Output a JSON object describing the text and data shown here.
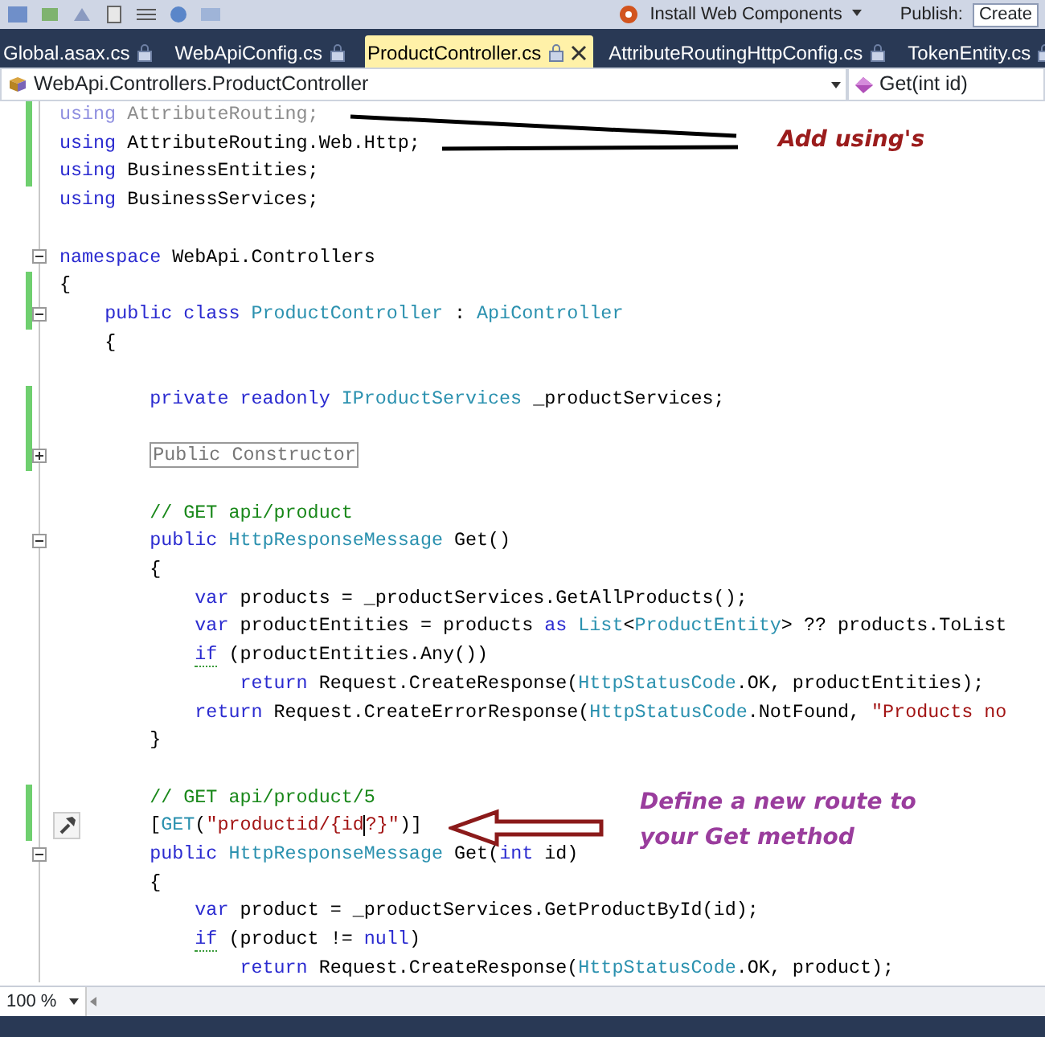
{
  "toolbar": {
    "install_button": "Install Web Components",
    "publish_label": "Publish:",
    "publish_field": "Create"
  },
  "tabs": [
    {
      "label": "Global.asax.cs",
      "selected": false
    },
    {
      "label": "WebApiConfig.cs",
      "selected": false
    },
    {
      "label": "ProductController.cs",
      "selected": true
    },
    {
      "label": "AttributeRoutingHttpConfig.cs",
      "selected": false
    },
    {
      "label": "TokenEntity.cs",
      "selected": false
    }
  ],
  "navigation": {
    "type_dropdown": "WebApi.Controllers.ProductController",
    "member_dropdown": "Get(int id)"
  },
  "editor": {
    "lines": [
      {
        "changed": true,
        "tokens": [
          {
            "kind": "keyword_dim",
            "text": "using "
          },
          {
            "kind": "dim",
            "text": "AttributeRouting;"
          }
        ]
      },
      {
        "changed": true,
        "tokens": [
          {
            "kind": "keyword",
            "text": "using "
          },
          {
            "kind": "plain",
            "text": "AttributeRouting.Web.Http;"
          }
        ]
      },
      {
        "changed": true,
        "tokens": [
          {
            "kind": "keyword",
            "text": "using "
          },
          {
            "kind": "plain",
            "text": "BusinessEntities;"
          }
        ]
      },
      {
        "changed": false,
        "tokens": [
          {
            "kind": "keyword",
            "text": "using "
          },
          {
            "kind": "plain",
            "text": "BusinessServices;"
          }
        ]
      },
      {
        "changed": false
      },
      {
        "changed": false,
        "expanded": true,
        "tokens": [
          {
            "kind": "keyword",
            "text": "namespace "
          },
          {
            "kind": "plain",
            "text": "WebApi.Controllers"
          }
        ]
      },
      {
        "changed": true,
        "tokens": [
          {
            "kind": "plain",
            "text": "{"
          }
        ]
      },
      {
        "changed": true,
        "expanded": true,
        "tokens": [
          {
            "kind": "keyword",
            "text": "    public class "
          },
          {
            "kind": "type",
            "text": "ProductController"
          },
          {
            "kind": "plain",
            "text": " : "
          },
          {
            "kind": "type",
            "text": "ApiController"
          }
        ]
      },
      {
        "changed": false,
        "tokens": [
          {
            "kind": "plain",
            "text": "    {"
          }
        ]
      },
      {
        "changed": false
      },
      {
        "changed": true,
        "tokens": [
          {
            "kind": "keyword",
            "text": "        private readonly "
          },
          {
            "kind": "type",
            "text": "IProductServices"
          },
          {
            "kind": "plain",
            "text": " _productServices;"
          }
        ]
      },
      {
        "changed": true
      },
      {
        "changed": true,
        "expanded": false,
        "tokens": [
          {
            "kind": "collapsed",
            "text": "        Public Constructor"
          }
        ]
      },
      {
        "changed": false
      },
      {
        "changed": false,
        "tokens": [
          {
            "kind": "comment",
            "text": "        // GET api/product"
          }
        ]
      },
      {
        "changed": false,
        "expanded": true,
        "tokens": [
          {
            "kind": "keyword",
            "text": "        public "
          },
          {
            "kind": "type",
            "text": "HttpResponseMessage"
          },
          {
            "kind": "plain",
            "text": " Get()"
          }
        ]
      },
      {
        "changed": false,
        "tokens": [
          {
            "kind": "plain",
            "text": "        {"
          }
        ]
      },
      {
        "changed": false,
        "tokens": [
          {
            "kind": "keyword",
            "text": "            var "
          },
          {
            "kind": "plain",
            "text": "products = _productServices.GetAllProducts();"
          }
        ]
      },
      {
        "changed": false,
        "tokens": [
          {
            "kind": "keyword",
            "text": "            var "
          },
          {
            "kind": "plain",
            "text": "productEntities = products "
          },
          {
            "kind": "keyword",
            "text": "as "
          },
          {
            "kind": "type",
            "text": "List"
          },
          {
            "kind": "plain",
            "text": "<"
          },
          {
            "kind": "type",
            "text": "ProductEntity"
          },
          {
            "kind": "plain",
            "text": "> ?? products.ToList"
          }
        ]
      },
      {
        "changed": false,
        "tokens": [
          {
            "kind": "keyword_squiggle",
            "text": "            if"
          },
          {
            "kind": "plain",
            "text": " (productEntities.Any())"
          }
        ]
      },
      {
        "changed": false,
        "tokens": [
          {
            "kind": "keyword",
            "text": "                return "
          },
          {
            "kind": "plain",
            "text": "Request.CreateResponse("
          },
          {
            "kind": "type",
            "text": "HttpStatusCode"
          },
          {
            "kind": "plain",
            "text": ".OK, productEntities);"
          }
        ]
      },
      {
        "changed": false,
        "tokens": [
          {
            "kind": "keyword",
            "text": "            return "
          },
          {
            "kind": "plain",
            "text": "Request.CreateErrorResponse("
          },
          {
            "kind": "type",
            "text": "HttpStatusCode"
          },
          {
            "kind": "plain",
            "text": ".NotFound, "
          },
          {
            "kind": "string",
            "text": "\"Products no"
          }
        ]
      },
      {
        "changed": false,
        "tokens": [
          {
            "kind": "plain",
            "text": "        }"
          }
        ]
      },
      {
        "changed": false
      },
      {
        "changed": true,
        "tokens": [
          {
            "kind": "comment",
            "text": "        // GET api/product/5"
          }
        ]
      },
      {
        "changed": true,
        "smart_tag": true,
        "tokens": [
          {
            "kind": "plain",
            "text": "        ["
          },
          {
            "kind": "type",
            "text": "GET"
          },
          {
            "kind": "plain",
            "text": "("
          },
          {
            "kind": "string",
            "text": "\"productid/{id"
          },
          {
            "kind": "caret"
          },
          {
            "kind": "string",
            "text": "?}\""
          },
          {
            "kind": "plain",
            "text": ")]"
          }
        ]
      },
      {
        "changed": false,
        "expanded": true,
        "tokens": [
          {
            "kind": "keyword",
            "text": "        public "
          },
          {
            "kind": "type",
            "text": "HttpResponseMessage"
          },
          {
            "kind": "plain",
            "text": " Get("
          },
          {
            "kind": "keyword",
            "text": "int"
          },
          {
            "kind": "plain",
            "text": " id)"
          }
        ]
      },
      {
        "changed": false,
        "tokens": [
          {
            "kind": "plain",
            "text": "        {"
          }
        ]
      },
      {
        "changed": false,
        "tokens": [
          {
            "kind": "keyword",
            "text": "            var "
          },
          {
            "kind": "plain",
            "text": "product = _productServices.GetProductById(id);"
          }
        ]
      },
      {
        "changed": false,
        "tokens": [
          {
            "kind": "keyword_squiggle",
            "text": "            if"
          },
          {
            "kind": "plain",
            "text": " (product != "
          },
          {
            "kind": "keyword",
            "text": "null"
          },
          {
            "kind": "plain",
            "text": ")"
          }
        ]
      },
      {
        "changed": false,
        "tokens": [
          {
            "kind": "keyword",
            "text": "                return "
          },
          {
            "kind": "plain",
            "text": "Request.CreateResponse("
          },
          {
            "kind": "type",
            "text": "HttpStatusCode"
          },
          {
            "kind": "plain",
            "text": ".OK, product);"
          }
        ]
      }
    ]
  },
  "annotations": [
    {
      "kind": "pointer_lines",
      "lines": [
        "Add using's"
      ]
    },
    {
      "kind": "arrow",
      "lines": [
        "Define a new route to",
        "your Get method"
      ]
    }
  ],
  "status_bar": {
    "zoom": "100 %"
  }
}
